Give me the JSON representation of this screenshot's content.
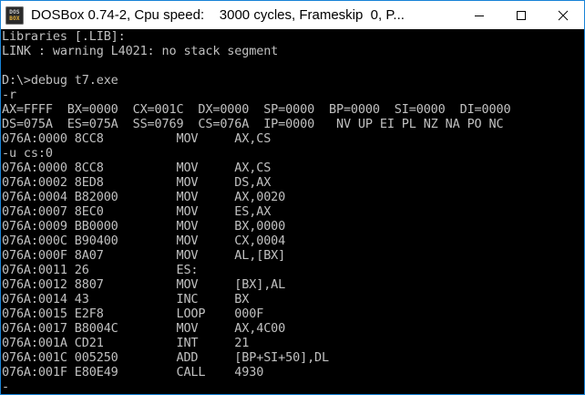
{
  "window": {
    "title": "DOSBox 0.74-2, Cpu speed:    3000 cycles, Frameskip  0, P...",
    "icon_lines": [
      "DOS",
      "BOX"
    ],
    "controls": [
      "minimize-icon",
      "maximize-icon",
      "close-icon"
    ]
  },
  "console": {
    "lines": [
      "Libraries [.LIB]:",
      "LINK : warning L4021: no stack segment",
      "",
      "D:\\>debug t7.exe",
      "-r",
      "AX=FFFF  BX=0000  CX=001C  DX=0000  SP=0000  BP=0000  SI=0000  DI=0000",
      "DS=075A  ES=075A  SS=0769  CS=076A  IP=0000   NV UP EI PL NZ NA PO NC",
      "076A:0000 8CC8          MOV     AX,CS",
      "-u cs:0",
      "076A:0000 8CC8          MOV     AX,CS",
      "076A:0002 8ED8          MOV     DS,AX",
      "076A:0004 B82000        MOV     AX,0020",
      "076A:0007 8EC0          MOV     ES,AX",
      "076A:0009 BB0000        MOV     BX,0000",
      "076A:000C B90400        MOV     CX,0004",
      "076A:000F 8A07          MOV     AL,[BX]",
      "076A:0011 26            ES:",
      "076A:0012 8807          MOV     [BX],AL",
      "076A:0014 43            INC     BX",
      "076A:0015 E2F8          LOOP    000F",
      "076A:0017 B8004C        MOV     AX,4C00",
      "076A:001A CD21          INT     21",
      "076A:001C 005250        ADD     [BP+SI+50],DL",
      "076A:001F E80E49        CALL    4930",
      "-"
    ]
  },
  "colors": {
    "console_bg": "#000000",
    "console_text": "#c0c0c0",
    "titlebar_bg": "#ffffff",
    "window_border": "#1883d7"
  }
}
